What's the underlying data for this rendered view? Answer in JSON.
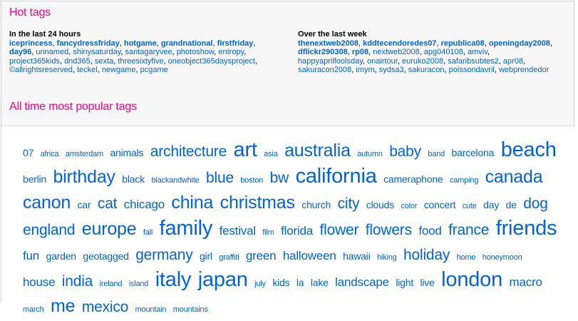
{
  "hot_tags": {
    "title": "Hot tags",
    "last_24": {
      "title": "In the last 24 hours",
      "tags": [
        {
          "t": "iceprincess",
          "b": true
        },
        {
          "t": "fancydressfriday",
          "b": true
        },
        {
          "t": "hotgame",
          "b": true
        },
        {
          "t": "grandnational",
          "b": true
        },
        {
          "t": "firstfriday",
          "b": true
        },
        {
          "t": "day96",
          "b": true
        },
        {
          "t": "unnamed",
          "b": false
        },
        {
          "t": "shinysaturday",
          "b": false
        },
        {
          "t": "santagaryvee",
          "b": false
        },
        {
          "t": "photoshow",
          "b": false
        },
        {
          "t": "entropy",
          "b": false
        },
        {
          "t": "project365kids",
          "b": false
        },
        {
          "t": "dnd365",
          "b": false
        },
        {
          "t": "sexta",
          "b": false
        },
        {
          "t": "threesixtyfive",
          "b": false
        },
        {
          "t": "oneobject365daysproject",
          "b": false
        },
        {
          "t": "©allrightsreserved",
          "b": false
        },
        {
          "t": "teckel",
          "b": false
        },
        {
          "t": "newgame",
          "b": false
        },
        {
          "t": "pcgame",
          "b": false
        }
      ]
    },
    "last_week": {
      "title": "Over the last week",
      "tags": [
        {
          "t": "thenextweb2008",
          "b": true
        },
        {
          "t": "kddtecendoredes07",
          "b": true
        },
        {
          "t": "republica08",
          "b": true
        },
        {
          "t": "openingday2008",
          "b": true
        },
        {
          "t": "dflickr290308",
          "b": true
        },
        {
          "t": "rp08",
          "b": true
        },
        {
          "t": "nextweb2008",
          "b": false
        },
        {
          "t": "apg040108",
          "b": false
        },
        {
          "t": "amviv",
          "b": false
        },
        {
          "t": "happyaprilfoolsday",
          "b": false
        },
        {
          "t": "onairtour",
          "b": false
        },
        {
          "t": "euruko2008",
          "b": false
        },
        {
          "t": "safaribsubtes2",
          "b": false
        },
        {
          "t": "apr08",
          "b": false
        },
        {
          "t": "sakuracon2008",
          "b": false
        },
        {
          "t": "imym",
          "b": false
        },
        {
          "t": "sydsa3",
          "b": false
        },
        {
          "t": "sakuracon",
          "b": false
        },
        {
          "t": "poissondavril",
          "b": false
        },
        {
          "t": "webprendedor",
          "b": false
        }
      ]
    }
  },
  "popular": {
    "title": "All time most popular tags",
    "tags": [
      {
        "t": "07",
        "s": 2
      },
      {
        "t": "africa",
        "s": 1
      },
      {
        "t": "amsterdam",
        "s": 1
      },
      {
        "t": "animals",
        "s": 2
      },
      {
        "t": "architecture",
        "s": 4
      },
      {
        "t": "art",
        "s": 6
      },
      {
        "t": "asia",
        "s": 1
      },
      {
        "t": "australia",
        "s": 5
      },
      {
        "t": "autumn",
        "s": 1
      },
      {
        "t": "baby",
        "s": 4
      },
      {
        "t": "band",
        "s": 1
      },
      {
        "t": "barcelona",
        "s": 2
      },
      {
        "t": "beach",
        "s": 6
      },
      {
        "t": "berlin",
        "s": 2
      },
      {
        "t": "birthday",
        "s": 5
      },
      {
        "t": "black",
        "s": 2
      },
      {
        "t": "blackandwhite",
        "s": 1
      },
      {
        "t": "blue",
        "s": 4
      },
      {
        "t": "boston",
        "s": 1
      },
      {
        "t": "bw",
        "s": 4
      },
      {
        "t": "california",
        "s": 6
      },
      {
        "t": "cameraphone",
        "s": 2
      },
      {
        "t": "camping",
        "s": 1
      },
      {
        "t": "canada",
        "s": 5
      },
      {
        "t": "canon",
        "s": 5
      },
      {
        "t": "car",
        "s": 2
      },
      {
        "t": "cat",
        "s": 4
      },
      {
        "t": "chicago",
        "s": 3
      },
      {
        "t": "china",
        "s": 5
      },
      {
        "t": "christmas",
        "s": 5
      },
      {
        "t": "church",
        "s": 2
      },
      {
        "t": "city",
        "s": 4
      },
      {
        "t": "clouds",
        "s": 2
      },
      {
        "t": "color",
        "s": 1
      },
      {
        "t": "concert",
        "s": 2
      },
      {
        "t": "cute",
        "s": 1
      },
      {
        "t": "day",
        "s": 2
      },
      {
        "t": "de",
        "s": 2
      },
      {
        "t": "dog",
        "s": 4
      },
      {
        "t": "england",
        "s": 4
      },
      {
        "t": "europe",
        "s": 5
      },
      {
        "t": "fall",
        "s": 1
      },
      {
        "t": "family",
        "s": 6
      },
      {
        "t": "festival",
        "s": 3
      },
      {
        "t": "film",
        "s": 1
      },
      {
        "t": "florida",
        "s": 3
      },
      {
        "t": "flower",
        "s": 4
      },
      {
        "t": "flowers",
        "s": 4
      },
      {
        "t": "food",
        "s": 3
      },
      {
        "t": "france",
        "s": 4
      },
      {
        "t": "friends",
        "s": 6
      },
      {
        "t": "fun",
        "s": 3
      },
      {
        "t": "garden",
        "s": 2
      },
      {
        "t": "geotagged",
        "s": 2
      },
      {
        "t": "germany",
        "s": 4
      },
      {
        "t": "girl",
        "s": 2
      },
      {
        "t": "graffiti",
        "s": 1
      },
      {
        "t": "green",
        "s": 3
      },
      {
        "t": "halloween",
        "s": 3
      },
      {
        "t": "hawaii",
        "s": 2
      },
      {
        "t": "hiking",
        "s": 1
      },
      {
        "t": "holiday",
        "s": 4
      },
      {
        "t": "home",
        "s": 1
      },
      {
        "t": "honeymoon",
        "s": 1
      },
      {
        "t": "house",
        "s": 3
      },
      {
        "t": "india",
        "s": 4
      },
      {
        "t": "ireland",
        "s": 1
      },
      {
        "t": "island",
        "s": 1
      },
      {
        "t": "italy",
        "s": 6
      },
      {
        "t": "japan",
        "s": 6
      },
      {
        "t": "july",
        "s": 1
      },
      {
        "t": "kids",
        "s": 2
      },
      {
        "t": "la",
        "s": 2
      },
      {
        "t": "lake",
        "s": 2
      },
      {
        "t": "landscape",
        "s": 3
      },
      {
        "t": "light",
        "s": 2
      },
      {
        "t": "live",
        "s": 2
      },
      {
        "t": "london",
        "s": 6
      },
      {
        "t": "macro",
        "s": 3
      },
      {
        "t": "march",
        "s": 1
      },
      {
        "t": "me",
        "s": 5
      },
      {
        "t": "mexico",
        "s": 4
      },
      {
        "t": "mountain",
        "s": 1
      },
      {
        "t": "mountains",
        "s": 1
      }
    ]
  }
}
